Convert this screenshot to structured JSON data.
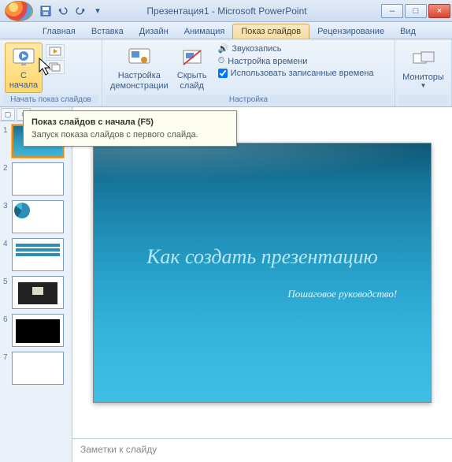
{
  "titlebar": {
    "title": "Презентация1 - Microsoft PowerPoint"
  },
  "win": {
    "min": "–",
    "max": "□",
    "close": "×"
  },
  "tabs": {
    "items": [
      "Главная",
      "Вставка",
      "Дизайн",
      "Анимация",
      "Показ слайдов",
      "Рецензирование",
      "Вид"
    ],
    "active_index": 4
  },
  "ribbon": {
    "group1": {
      "label": "Начать показ слайдов",
      "btn_from_start": "С\nначала"
    },
    "group2": {
      "label": "Настройка",
      "btn_setup": "Настройка\nдемонстрации",
      "btn_hide": "Скрыть\nслайд",
      "cb1": "Звукозапись",
      "cb2": "Настройка времени",
      "cb3": "Использовать записанные времена"
    },
    "group3": {
      "label": "",
      "btn_monitors": "Мониторы"
    }
  },
  "tooltip": {
    "title": "Показ слайдов с начала (F5)",
    "desc": "Запуск показа слайдов с первого слайда."
  },
  "slides": {
    "count": 7,
    "selected": 1,
    "slide1": {
      "title": "Как создать презентацию",
      "subtitle": "Пошаговое руководство!"
    }
  },
  "notes": {
    "placeholder": "Заметки к слайду"
  }
}
